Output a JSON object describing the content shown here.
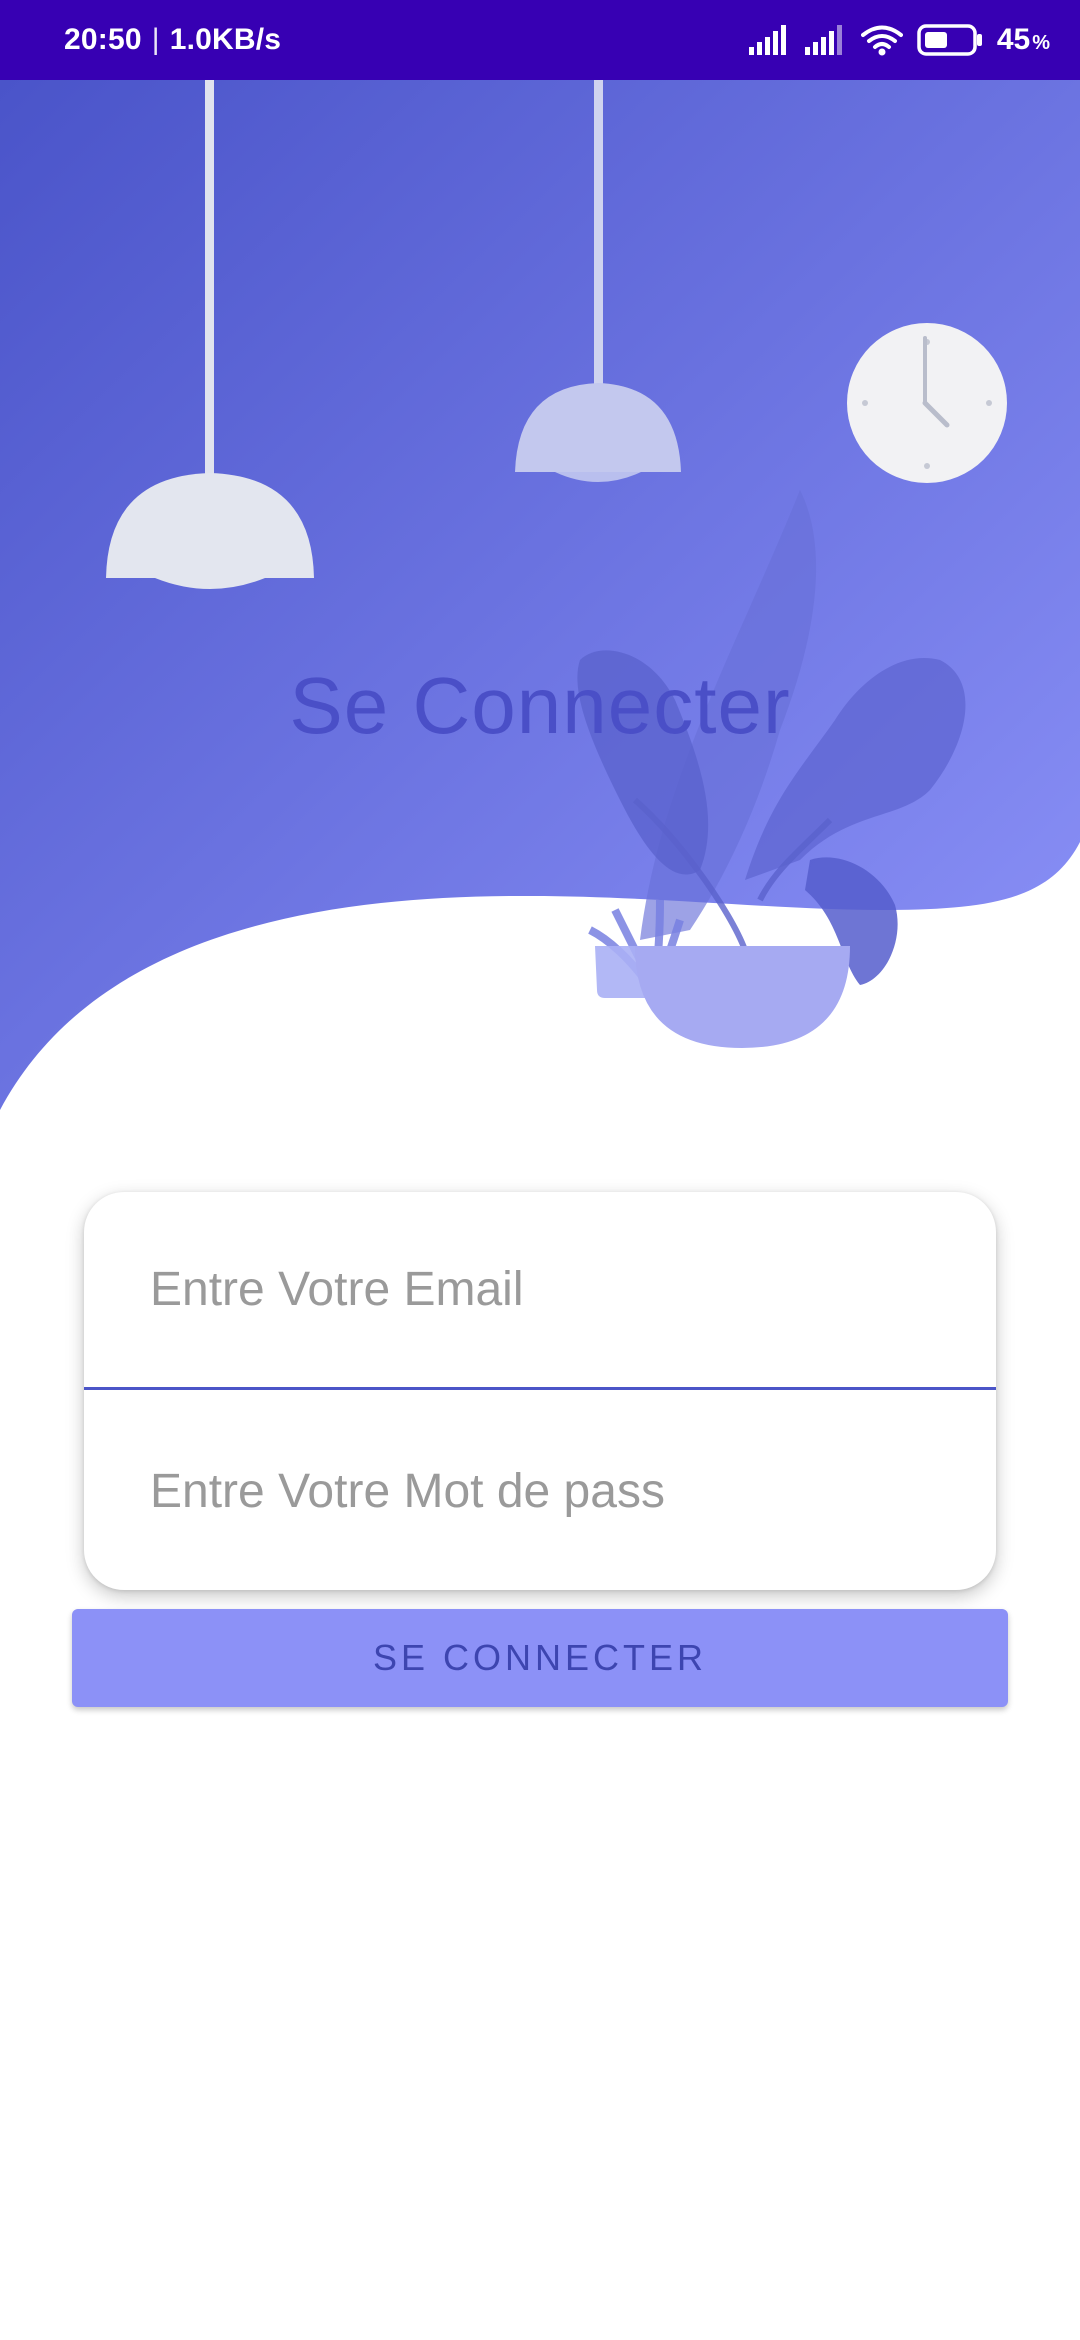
{
  "status_bar": {
    "time": "20:50",
    "network_speed": "1.0KB/s",
    "battery_level": "45",
    "battery_unit": "%",
    "icons": [
      "signal-icon",
      "signal-icon",
      "wifi-icon",
      "battery-icon"
    ]
  },
  "header": {
    "title": "Se Connecter",
    "illustration": [
      "lamp-icon",
      "lamp-icon",
      "clock-icon",
      "plant-icon"
    ]
  },
  "form": {
    "email_placeholder": "Entre Votre Email",
    "password_placeholder": "Entre Votre Mot de pass",
    "email_value": "",
    "password_value": ""
  },
  "login_button_label": "SE CONNECTER",
  "colors": {
    "status_bar": "#3700b3",
    "header_gradient_start": "#4a54c9",
    "header_gradient_end": "#8d93f9",
    "title": "#4a4fc7",
    "button": "#8c91f7",
    "button_text": "#3d45b0",
    "field_underline": "#4b55c8"
  }
}
